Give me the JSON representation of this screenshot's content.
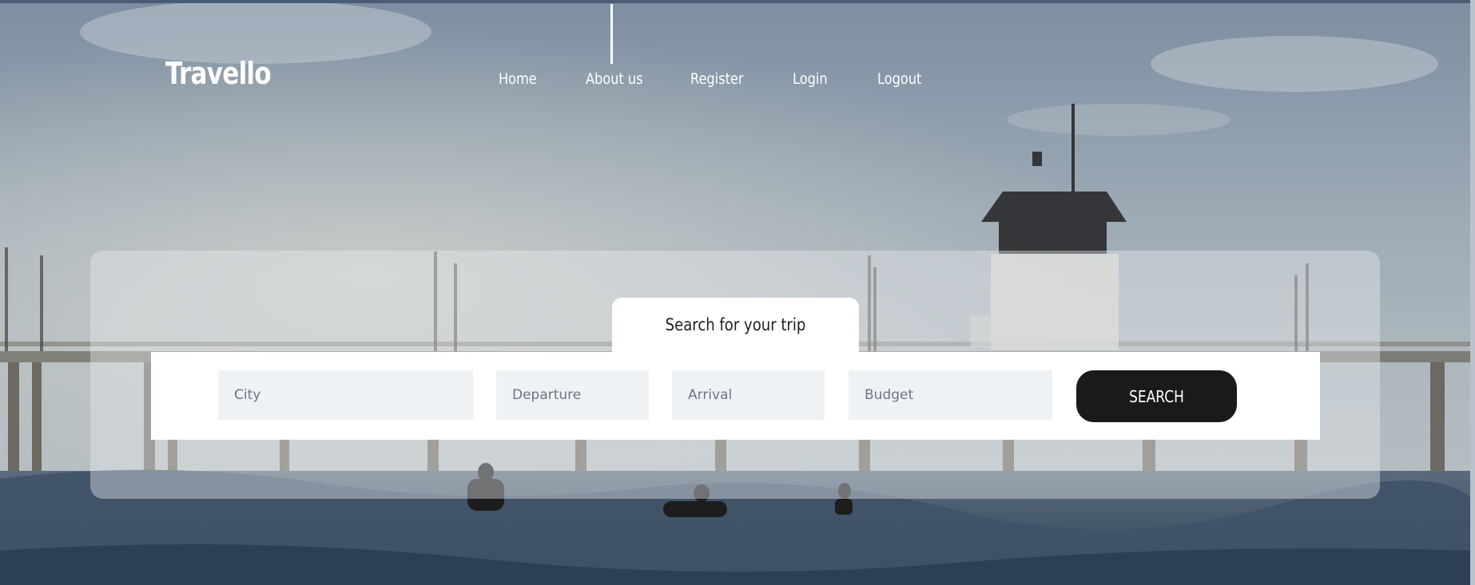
{
  "brand": {
    "logo_text": "Travello"
  },
  "nav": {
    "items": [
      {
        "label": "Home"
      },
      {
        "label": "About us"
      },
      {
        "label": "Register"
      },
      {
        "label": "Login"
      },
      {
        "label": "Logout"
      }
    ],
    "active_index": 1
  },
  "search": {
    "tab_title": "Search for your trip",
    "city_placeholder": "City",
    "departure_placeholder": "Departure",
    "arrival_placeholder": "Arrival",
    "budget_placeholder": "Budget",
    "button_label": "SEARCH"
  },
  "colors": {
    "button_bg": "#1a1a1a",
    "field_bg": "#eff2f4",
    "nav_text": "#ffffff"
  }
}
